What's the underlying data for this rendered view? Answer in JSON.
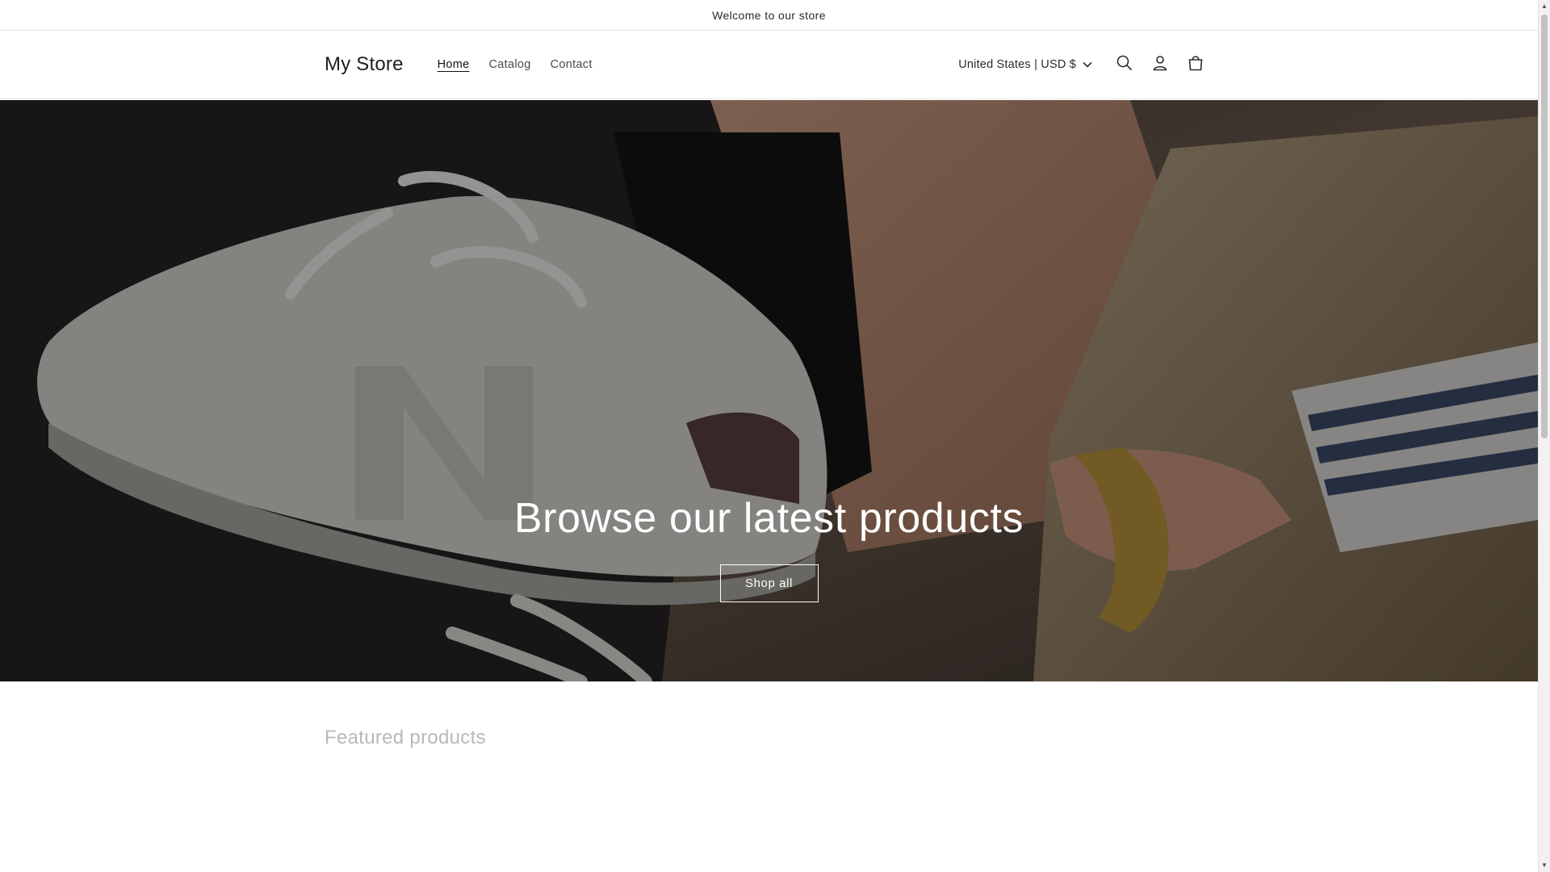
{
  "announcement": {
    "text": "Welcome to our store"
  },
  "header": {
    "logo": "My Store",
    "nav": [
      {
        "label": "Home",
        "active": true
      },
      {
        "label": "Catalog",
        "active": false
      },
      {
        "label": "Contact",
        "active": false
      }
    ],
    "currency": "United States | USD $",
    "icons": [
      "search-icon",
      "account-icon",
      "cart-icon"
    ]
  },
  "hero": {
    "title": "Browse our latest products",
    "button": "Shop all"
  },
  "featured": {
    "title": "Featured products"
  },
  "colors": {
    "text": "#121212",
    "muted": "#b8b8b8",
    "border": "#e6e6e6",
    "hero_text": "#ffffff"
  }
}
